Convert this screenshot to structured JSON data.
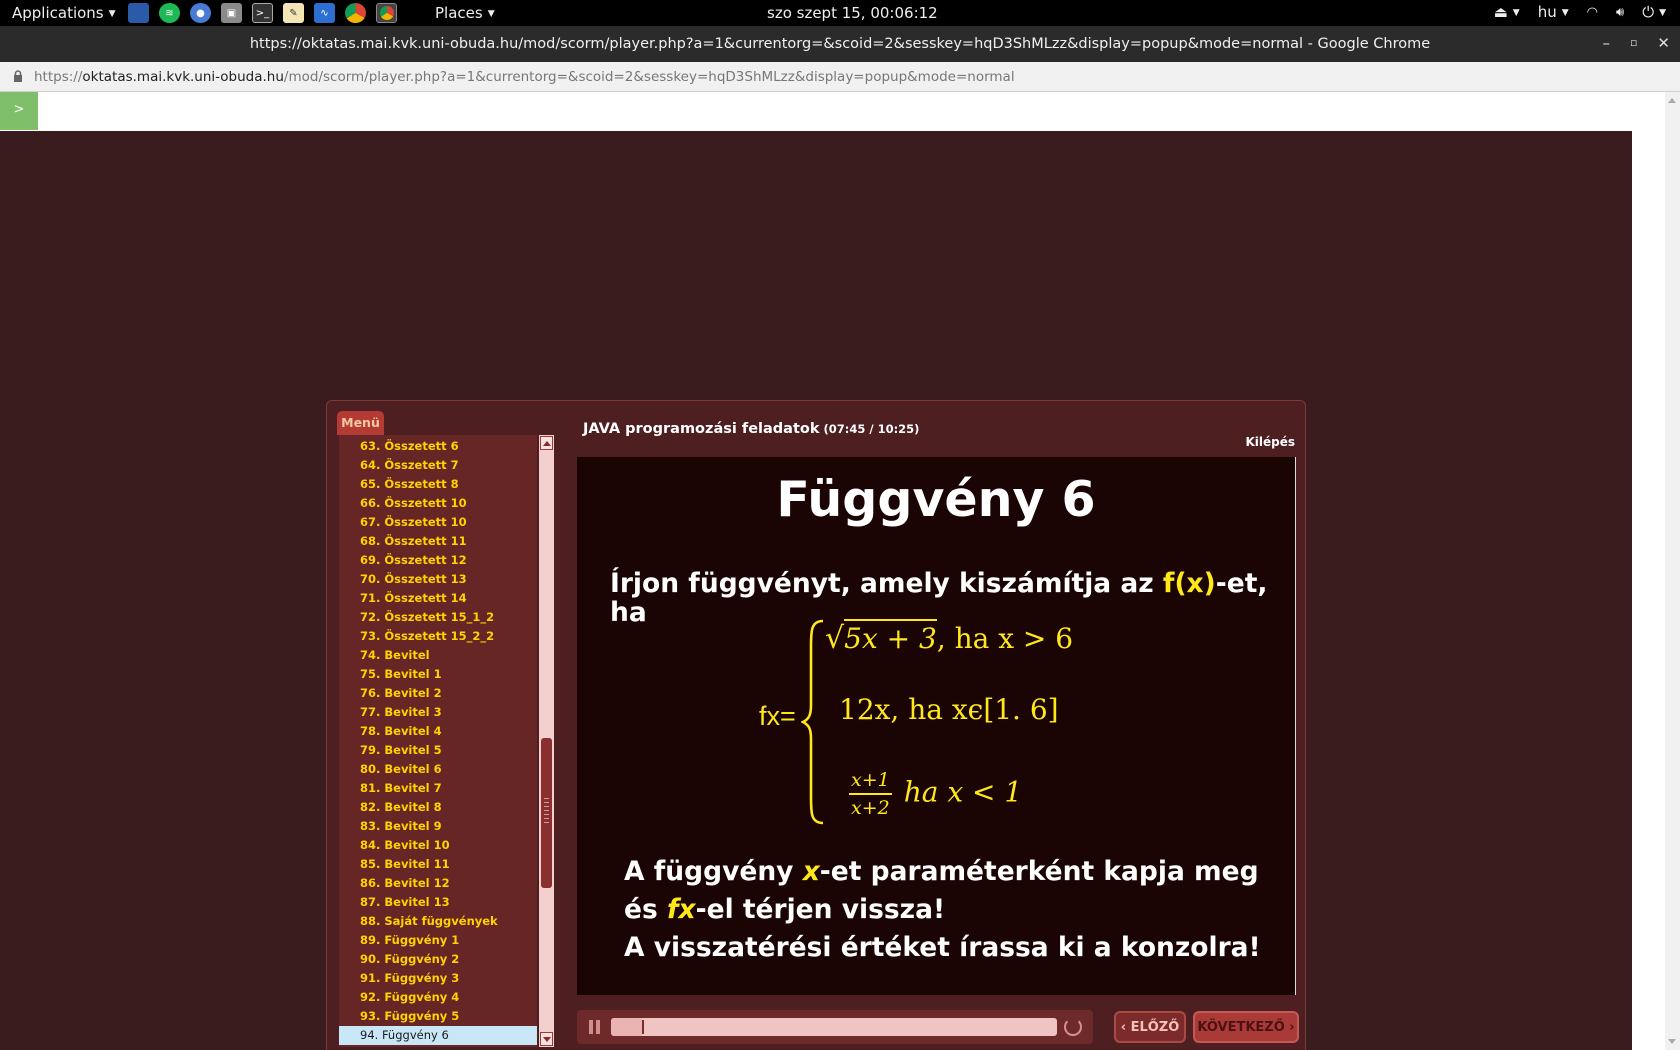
{
  "top_panel": {
    "applications_label": "Applications",
    "places_label": "Places",
    "clock": "szo szept 15, 00:06:12",
    "language": "hu"
  },
  "window": {
    "title": "https://oktatas.mai.kvk.uni-obuda.hu/mod/scorm/player.php?a=1&currentorg=&scoid=2&sesskey=hqD3ShMLzz&display=popup&mode=normal - Google Chrome"
  },
  "address_bar": {
    "scheme": "https://",
    "host": "oktatas.mai.kvk.uni-obuda.hu",
    "path": "/mod/scorm/player.php?a=1&currentorg=&scoid=2&sesskey=hqD3ShMLzz&display=popup&mode=normal"
  },
  "page": {
    "toc_toggle": ">"
  },
  "player": {
    "menu_tab": "Menü",
    "course_title": "JAVA programozási feladatok",
    "time": "(07:45 / 10:25)",
    "exit": "Kilépés",
    "prev": "ELŐZŐ",
    "next": "KÖVETKEZŐ",
    "progress_fraction": 0.07,
    "menu_items": [
      "63. Összetett 6",
      "64. Összetett 7",
      "65. Összetett 8",
      "66. Összetett 10",
      "67. Összetett 10",
      "68. Összetett 11",
      "69. Összetett 12",
      "70. Összetett 13",
      "71. Összetett 14",
      "72. Összetett 15_1_2",
      "73. Összetett 15_2_2",
      "74. Bevitel",
      "75. Bevitel 1",
      "76. Bevitel 2",
      "77. Bevitel 3",
      "78. Bevitel 4",
      "79. Bevitel 5",
      "80. Bevitel 6",
      "81. Bevitel 7",
      "82. Bevitel 8",
      "83. Bevitel 9",
      "84. Bevitel 10",
      "85. Bevitel 11",
      "86. Bevitel 12",
      "87. Bevitel 13",
      "88. Saját függvények",
      "89. Függvény 1",
      "90. Függvény 2",
      "91. Függvény 3",
      "92. Függvény 4",
      "93. Függvény 5",
      "94. Függvény 6"
    ],
    "active_index": 31
  },
  "slide": {
    "title": "Függvény 6",
    "task_pre": "Írjon függvényt, amely kiszámítja az ",
    "task_highlight": "f(x)",
    "task_post": "-et, ha",
    "formula_lhs": "fx=",
    "case1_radicand": "5x + 3",
    "case1_cond": ", ha x > 6",
    "case2": "12x, ha xϵ[1. 6]",
    "case3_num": "x+1",
    "case3_den": "x+2",
    "case3_cond": "ha x < 1",
    "note1_a": "A függvény ",
    "note1_x": "x",
    "note1_b": "-et paraméterként kapja meg",
    "note2_a": "és ",
    "note2_fx": "fx",
    "note2_b": "-el térjen vissza!",
    "note3": "A visszatérési értéket írassa ki a konzolra!"
  }
}
